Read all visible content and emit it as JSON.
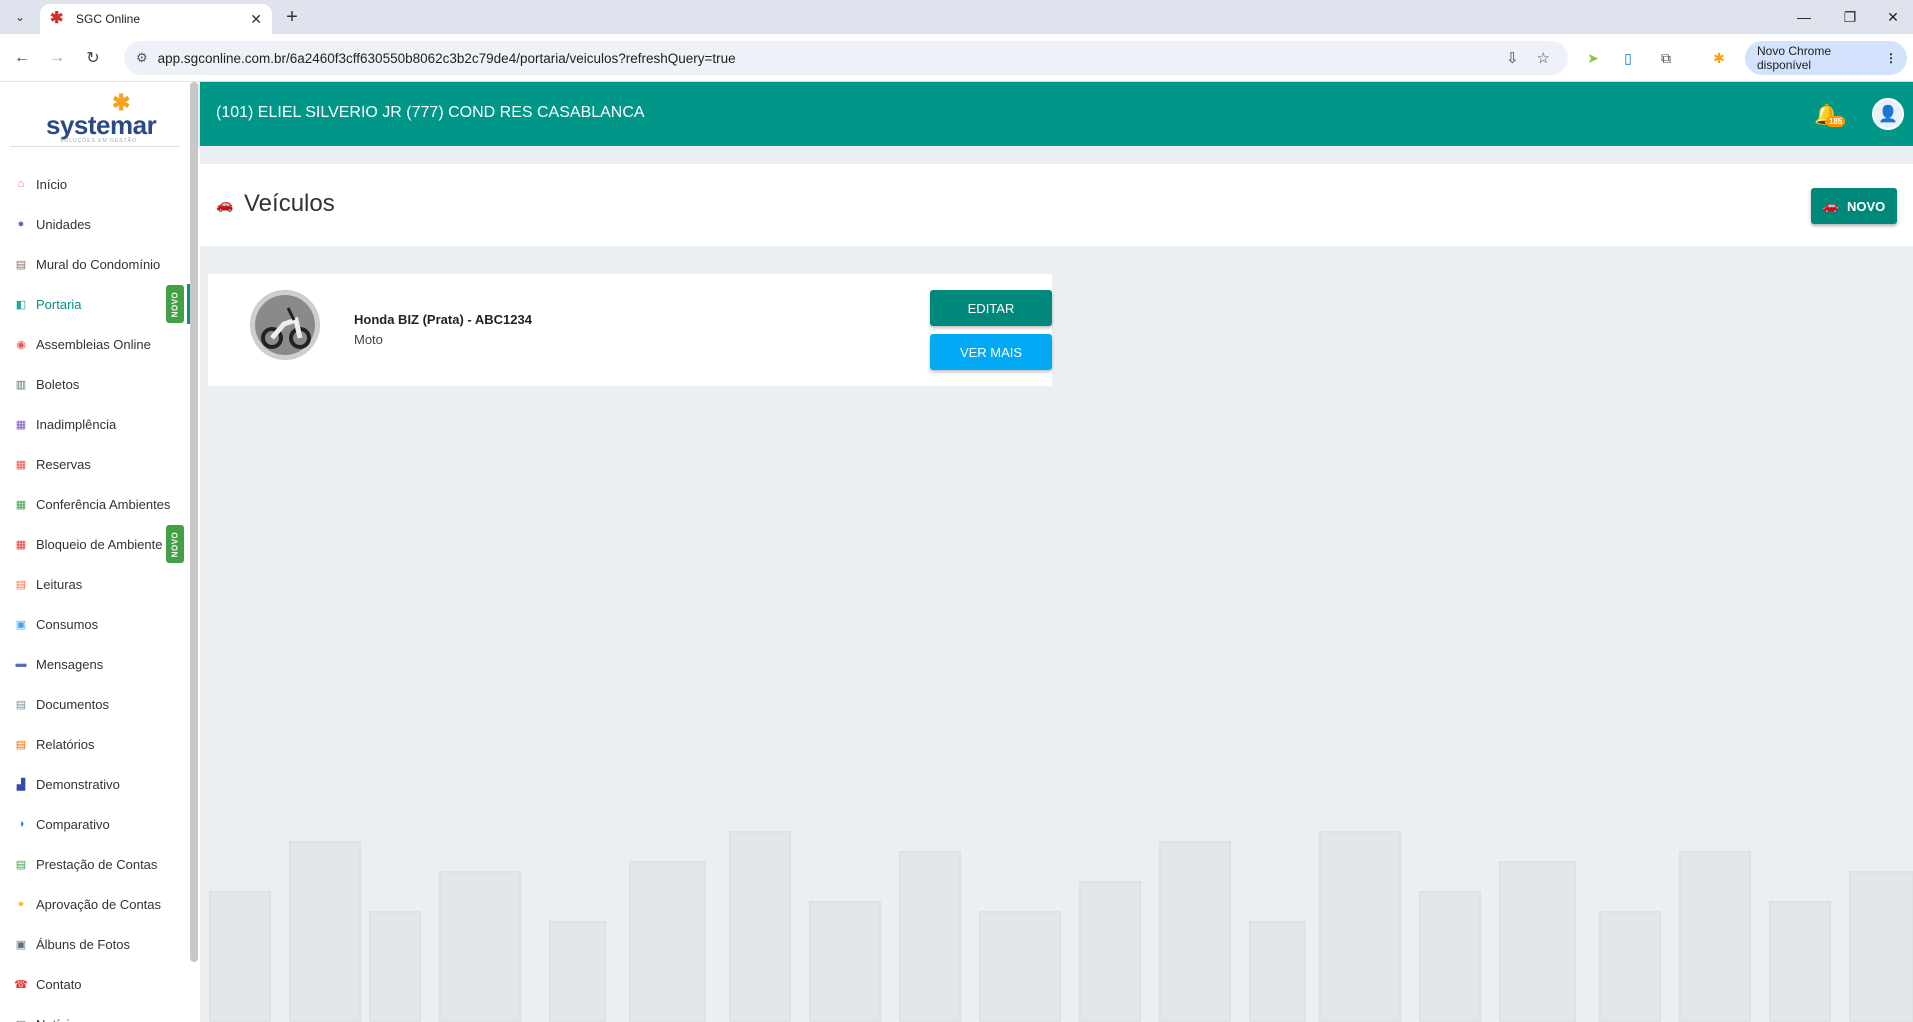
{
  "browser": {
    "tab_title": "SGC Online",
    "url": "app.sgconline.com.br/6a2460f3cff630550b8062c3b2c79de4/portaria/veiculos?refreshQuery=true",
    "update_label": "Novo Chrome disponível"
  },
  "sidebar": {
    "logo": "systemar",
    "logo_tagline": "SOLUÇÕES EM GESTÃO",
    "novo_badge": "NOVO",
    "items": [
      {
        "label": "Início",
        "icon": "home-icon",
        "color": "#e57373"
      },
      {
        "label": "Unidades",
        "icon": "person-icon",
        "color": "#5c6bc0"
      },
      {
        "label": "Mural do Condomínio",
        "icon": "board-icon",
        "color": "#8d6e63"
      },
      {
        "label": "Portaria",
        "icon": "door-icon",
        "color": "#26a69a"
      },
      {
        "label": "Assembleias Online",
        "icon": "meeting-icon",
        "color": "#ef5350"
      },
      {
        "label": "Boletos",
        "icon": "barcode-icon",
        "color": "#546e7a"
      },
      {
        "label": "Inadimplência",
        "icon": "report-icon",
        "color": "#7e57c2"
      },
      {
        "label": "Reservas",
        "icon": "calendar-icon",
        "color": "#ef5350"
      },
      {
        "label": "Conferência Ambientes",
        "icon": "calendar-check-icon",
        "color": "#43a047"
      },
      {
        "label": "Bloqueio de Ambiente",
        "icon": "calendar-block-icon",
        "color": "#e53935"
      },
      {
        "label": "Leituras",
        "icon": "reading-icon",
        "color": "#ff7043"
      },
      {
        "label": "Consumos",
        "icon": "consumption-icon",
        "color": "#42a5f5"
      },
      {
        "label": "Mensagens",
        "icon": "messages-icon",
        "color": "#5c6bc0"
      },
      {
        "label": "Documentos",
        "icon": "documents-icon",
        "color": "#78909c"
      },
      {
        "label": "Relatórios",
        "icon": "reports-icon",
        "color": "#ef6c00"
      },
      {
        "label": "Demonstrativo",
        "icon": "chart-icon",
        "color": "#3949ab"
      },
      {
        "label": "Comparativo",
        "icon": "compare-icon",
        "color": "#1e88e5"
      },
      {
        "label": "Prestação de Contas",
        "icon": "accounts-icon",
        "color": "#43a047"
      },
      {
        "label": "Aprovação de Contas",
        "icon": "approval-icon",
        "color": "#fbc02d"
      },
      {
        "label": "Álbuns de Fotos",
        "icon": "photo-album-icon",
        "color": "#546e7a"
      },
      {
        "label": "Contato",
        "icon": "phone-icon",
        "color": "#e53935"
      },
      {
        "label": "Notícias",
        "icon": "news-icon",
        "color": "#607d8b"
      }
    ]
  },
  "header": {
    "title": "(101) ELIEL SILVERIO JR  (777) COND RES CASABLANCA",
    "notification_count": "185"
  },
  "page": {
    "title": "Veículos",
    "new_button": "NOVO"
  },
  "vehicle": {
    "title": "Honda BIZ (Prata) - ABC1234",
    "type": "Moto",
    "edit_label": "EDITAR",
    "more_label": "VER MAIS"
  },
  "colors": {
    "primary": "#009688",
    "accent_blue": "#03a9f4",
    "background": "#eceff1"
  }
}
